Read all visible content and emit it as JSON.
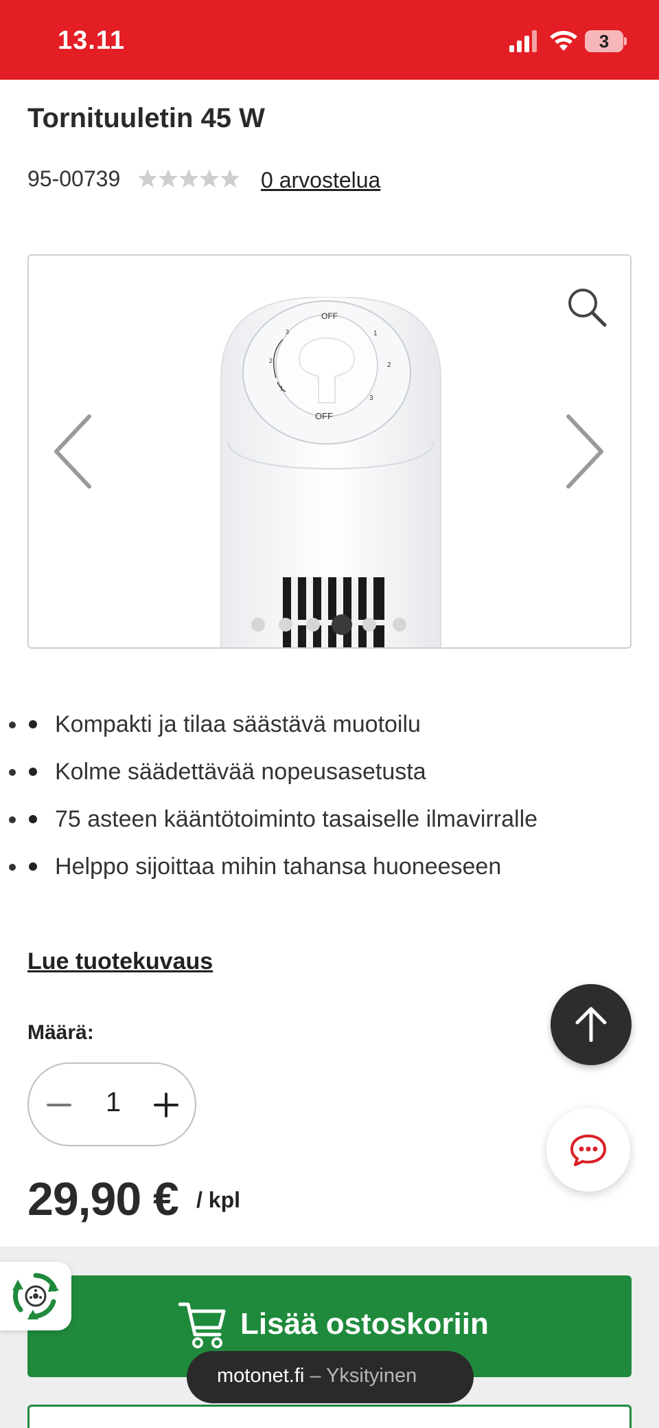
{
  "status_bar": {
    "time": "13.11",
    "battery": "3"
  },
  "product": {
    "title": "Tornituuletin 45 W",
    "sku": "95-00739",
    "rating_stars": 0,
    "reviews_link": "0 arvostelua"
  },
  "gallery": {
    "image_labels": {
      "top_off": "OFF",
      "bottom_off": "OFF",
      "speed_1_right": "1",
      "speed_2_right": "2",
      "speed_3_right": "3",
      "speed_3_left": "3",
      "speed_2_left": "2",
      "speed_1_left": "1"
    },
    "slide_count": 6,
    "active_slide": 4
  },
  "features": [
    "Kompakti ja tilaa säästävä muotoilu",
    "Kolme säädettävää nopeusasetusta",
    "75 asteen kääntötoiminto tasaiselle ilmavirralle",
    "Helppo sijoittaa mihin tahansa huoneeseen"
  ],
  "read_description_link": "Lue tuotekuvaus",
  "quantity": {
    "label": "Määrä:",
    "value": "1"
  },
  "price": {
    "amount": "29,90 €",
    "unit": "/ kpl"
  },
  "cart_button": {
    "label": "Lisää ostoskoriin"
  },
  "browser": {
    "domain": "motonet.fi",
    "separator": " – ",
    "mode": "Yksityinen"
  },
  "colors": {
    "brand_red": "#e31e24",
    "cart_green": "#1f8a3c",
    "dark": "#2d2d2d"
  }
}
